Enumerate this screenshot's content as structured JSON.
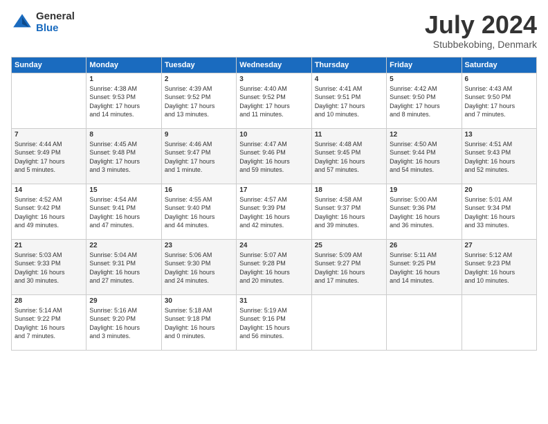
{
  "header": {
    "logo_general": "General",
    "logo_blue": "Blue",
    "month_title": "July 2024",
    "subtitle": "Stubbekobing, Denmark"
  },
  "days_of_week": [
    "Sunday",
    "Monday",
    "Tuesday",
    "Wednesday",
    "Thursday",
    "Friday",
    "Saturday"
  ],
  "weeks": [
    [
      {
        "day": "",
        "lines": []
      },
      {
        "day": "1",
        "lines": [
          "Sunrise: 4:38 AM",
          "Sunset: 9:53 PM",
          "Daylight: 17 hours",
          "and 14 minutes."
        ]
      },
      {
        "day": "2",
        "lines": [
          "Sunrise: 4:39 AM",
          "Sunset: 9:52 PM",
          "Daylight: 17 hours",
          "and 13 minutes."
        ]
      },
      {
        "day": "3",
        "lines": [
          "Sunrise: 4:40 AM",
          "Sunset: 9:52 PM",
          "Daylight: 17 hours",
          "and 11 minutes."
        ]
      },
      {
        "day": "4",
        "lines": [
          "Sunrise: 4:41 AM",
          "Sunset: 9:51 PM",
          "Daylight: 17 hours",
          "and 10 minutes."
        ]
      },
      {
        "day": "5",
        "lines": [
          "Sunrise: 4:42 AM",
          "Sunset: 9:50 PM",
          "Daylight: 17 hours",
          "and 8 minutes."
        ]
      },
      {
        "day": "6",
        "lines": [
          "Sunrise: 4:43 AM",
          "Sunset: 9:50 PM",
          "Daylight: 17 hours",
          "and 7 minutes."
        ]
      }
    ],
    [
      {
        "day": "7",
        "lines": [
          "Sunrise: 4:44 AM",
          "Sunset: 9:49 PM",
          "Daylight: 17 hours",
          "and 5 minutes."
        ]
      },
      {
        "day": "8",
        "lines": [
          "Sunrise: 4:45 AM",
          "Sunset: 9:48 PM",
          "Daylight: 17 hours",
          "and 3 minutes."
        ]
      },
      {
        "day": "9",
        "lines": [
          "Sunrise: 4:46 AM",
          "Sunset: 9:47 PM",
          "Daylight: 17 hours",
          "and 1 minute."
        ]
      },
      {
        "day": "10",
        "lines": [
          "Sunrise: 4:47 AM",
          "Sunset: 9:46 PM",
          "Daylight: 16 hours",
          "and 59 minutes."
        ]
      },
      {
        "day": "11",
        "lines": [
          "Sunrise: 4:48 AM",
          "Sunset: 9:45 PM",
          "Daylight: 16 hours",
          "and 57 minutes."
        ]
      },
      {
        "day": "12",
        "lines": [
          "Sunrise: 4:50 AM",
          "Sunset: 9:44 PM",
          "Daylight: 16 hours",
          "and 54 minutes."
        ]
      },
      {
        "day": "13",
        "lines": [
          "Sunrise: 4:51 AM",
          "Sunset: 9:43 PM",
          "Daylight: 16 hours",
          "and 52 minutes."
        ]
      }
    ],
    [
      {
        "day": "14",
        "lines": [
          "Sunrise: 4:52 AM",
          "Sunset: 9:42 PM",
          "Daylight: 16 hours",
          "and 49 minutes."
        ]
      },
      {
        "day": "15",
        "lines": [
          "Sunrise: 4:54 AM",
          "Sunset: 9:41 PM",
          "Daylight: 16 hours",
          "and 47 minutes."
        ]
      },
      {
        "day": "16",
        "lines": [
          "Sunrise: 4:55 AM",
          "Sunset: 9:40 PM",
          "Daylight: 16 hours",
          "and 44 minutes."
        ]
      },
      {
        "day": "17",
        "lines": [
          "Sunrise: 4:57 AM",
          "Sunset: 9:39 PM",
          "Daylight: 16 hours",
          "and 42 minutes."
        ]
      },
      {
        "day": "18",
        "lines": [
          "Sunrise: 4:58 AM",
          "Sunset: 9:37 PM",
          "Daylight: 16 hours",
          "and 39 minutes."
        ]
      },
      {
        "day": "19",
        "lines": [
          "Sunrise: 5:00 AM",
          "Sunset: 9:36 PM",
          "Daylight: 16 hours",
          "and 36 minutes."
        ]
      },
      {
        "day": "20",
        "lines": [
          "Sunrise: 5:01 AM",
          "Sunset: 9:34 PM",
          "Daylight: 16 hours",
          "and 33 minutes."
        ]
      }
    ],
    [
      {
        "day": "21",
        "lines": [
          "Sunrise: 5:03 AM",
          "Sunset: 9:33 PM",
          "Daylight: 16 hours",
          "and 30 minutes."
        ]
      },
      {
        "day": "22",
        "lines": [
          "Sunrise: 5:04 AM",
          "Sunset: 9:31 PM",
          "Daylight: 16 hours",
          "and 27 minutes."
        ]
      },
      {
        "day": "23",
        "lines": [
          "Sunrise: 5:06 AM",
          "Sunset: 9:30 PM",
          "Daylight: 16 hours",
          "and 24 minutes."
        ]
      },
      {
        "day": "24",
        "lines": [
          "Sunrise: 5:07 AM",
          "Sunset: 9:28 PM",
          "Daylight: 16 hours",
          "and 20 minutes."
        ]
      },
      {
        "day": "25",
        "lines": [
          "Sunrise: 5:09 AM",
          "Sunset: 9:27 PM",
          "Daylight: 16 hours",
          "and 17 minutes."
        ]
      },
      {
        "day": "26",
        "lines": [
          "Sunrise: 5:11 AM",
          "Sunset: 9:25 PM",
          "Daylight: 16 hours",
          "and 14 minutes."
        ]
      },
      {
        "day": "27",
        "lines": [
          "Sunrise: 5:12 AM",
          "Sunset: 9:23 PM",
          "Daylight: 16 hours",
          "and 10 minutes."
        ]
      }
    ],
    [
      {
        "day": "28",
        "lines": [
          "Sunrise: 5:14 AM",
          "Sunset: 9:22 PM",
          "Daylight: 16 hours",
          "and 7 minutes."
        ]
      },
      {
        "day": "29",
        "lines": [
          "Sunrise: 5:16 AM",
          "Sunset: 9:20 PM",
          "Daylight: 16 hours",
          "and 3 minutes."
        ]
      },
      {
        "day": "30",
        "lines": [
          "Sunrise: 5:18 AM",
          "Sunset: 9:18 PM",
          "Daylight: 16 hours",
          "and 0 minutes."
        ]
      },
      {
        "day": "31",
        "lines": [
          "Sunrise: 5:19 AM",
          "Sunset: 9:16 PM",
          "Daylight: 15 hours",
          "and 56 minutes."
        ]
      },
      {
        "day": "",
        "lines": []
      },
      {
        "day": "",
        "lines": []
      },
      {
        "day": "",
        "lines": []
      }
    ]
  ]
}
